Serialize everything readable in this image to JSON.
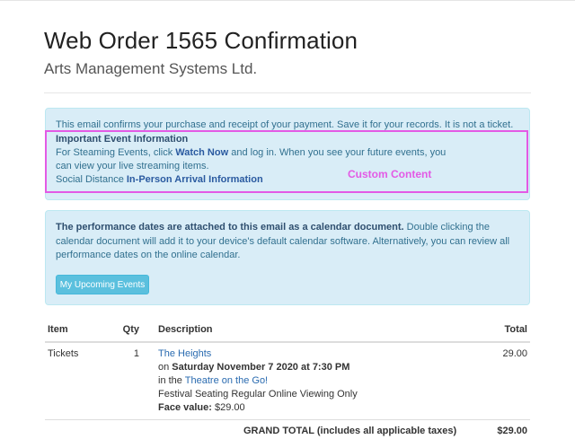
{
  "header": {
    "title": "Web Order 1565 Confirmation",
    "subtitle": "Arts Management Systems Ltd."
  },
  "notice": {
    "intro": "This email confirms your purchase and receipt of your payment. Save it for your records. It is not a ticket.",
    "heading": "Important Event Information",
    "streaming_prefix": "For Steaming Events, click ",
    "watch_now": "Watch Now",
    "streaming_suffix": " and log in. When you see your future events, you can view your live streaming items.",
    "social_prefix": "Social Distance ",
    "arrival_link": "In-Person Arrival Information",
    "custom_label": "Custom Content"
  },
  "calendar": {
    "bold": "The performance dates are attached to this email as a calendar document.",
    "text": " Double clicking the calendar document will add it to your device's default calendar software. Alternatively, you can review all performance dates on the online calendar.",
    "button": "My Upcoming Events"
  },
  "table": {
    "headers": {
      "item": "Item",
      "qty": "Qty",
      "description": "Description",
      "total": "Total"
    },
    "row": {
      "item": "Tickets",
      "qty": "1",
      "event": "The Heights",
      "on_prefix": "on ",
      "date": "Saturday November 7 2020 at 7:30 PM",
      "in_prefix": "in the ",
      "venue": "Theatre on the Go!",
      "seating": "Festival Seating Regular Online Viewing Only",
      "face_label": "Face value:",
      "face_value": " $29.00",
      "total": "29.00"
    },
    "grand_label": "GRAND TOTAL (includes all applicable taxes)",
    "grand_total": "$29.00"
  }
}
